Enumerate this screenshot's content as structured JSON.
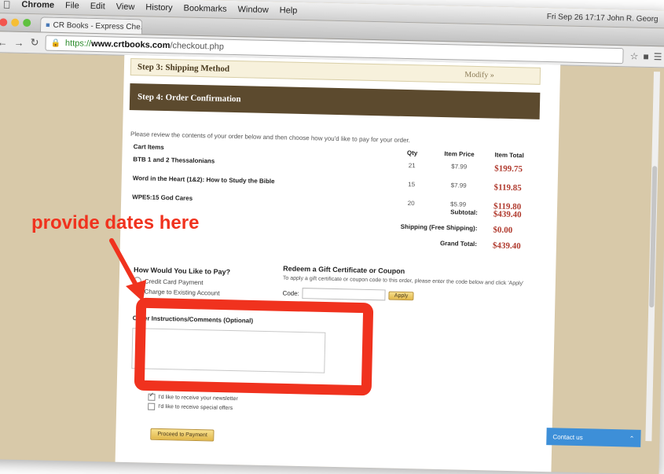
{
  "os_menubar": {
    "apple_icon": "apple-icon",
    "app_name": "Chrome",
    "items": [
      "File",
      "Edit",
      "View",
      "History",
      "Bookmarks",
      "Window",
      "Help"
    ],
    "status": "Fri Sep 26  17:17  John R. Georg"
  },
  "browser": {
    "tab_title": "CR Books - Express Che...",
    "tab_close": "×",
    "url_protocol": "https://",
    "url_domain": "www.crtbooks.com",
    "url_path": "/checkout.php"
  },
  "page": {
    "step3_title": "Step 3: Shipping Method",
    "step3_modify": "Modify »",
    "step4_title": "Step 4: Order Confirmation",
    "intro": "Please review the contents of your order below and then choose how you'd like to pay for your order.",
    "cart": {
      "headers": [
        "Cart Items",
        "Qty",
        "Item Price",
        "Item Total"
      ],
      "rows": [
        {
          "name": "BTB 1 and 2 Thessalonians",
          "qty": "21",
          "price": "$7.99",
          "total": "$199.75"
        },
        {
          "name": "Word in the Heart (1&2): How to Study the Bible",
          "qty": "15",
          "price": "$7.99",
          "total": "$119.85"
        },
        {
          "name": "WPE5:15 God Cares",
          "qty": "20",
          "price": "$5.99",
          "total": "$119.80"
        }
      ]
    },
    "totals": [
      {
        "label": "Subtotal:",
        "value": "$439.40"
      },
      {
        "label": "Shipping (Free Shipping):",
        "value": "$0.00"
      },
      {
        "label": "Grand Total:",
        "value": "$439.40"
      }
    ],
    "payment": {
      "title": "How Would You Like to Pay?",
      "options": [
        "Credit Card Payment",
        "Charge to Existing Account"
      ]
    },
    "coupon": {
      "title": "Redeem a Gift Certificate or Coupon",
      "desc": "To apply a gift certificate or coupon code to this order, please enter the code below and click 'Apply'",
      "code_label": "Code:",
      "apply": "Apply"
    },
    "instructions": {
      "title": "Order Instructions/Comments (Optional)",
      "value": ""
    },
    "checkboxes": [
      {
        "label": "I'd like to receive your newsletter",
        "checked": true
      },
      {
        "label": "I'd like to receive special offers",
        "checked": false
      }
    ],
    "proceed": "Proceed to Payment",
    "contact_us": "Contact us"
  },
  "annotation": {
    "text": "provide dates here",
    "color": "#f0321e"
  }
}
